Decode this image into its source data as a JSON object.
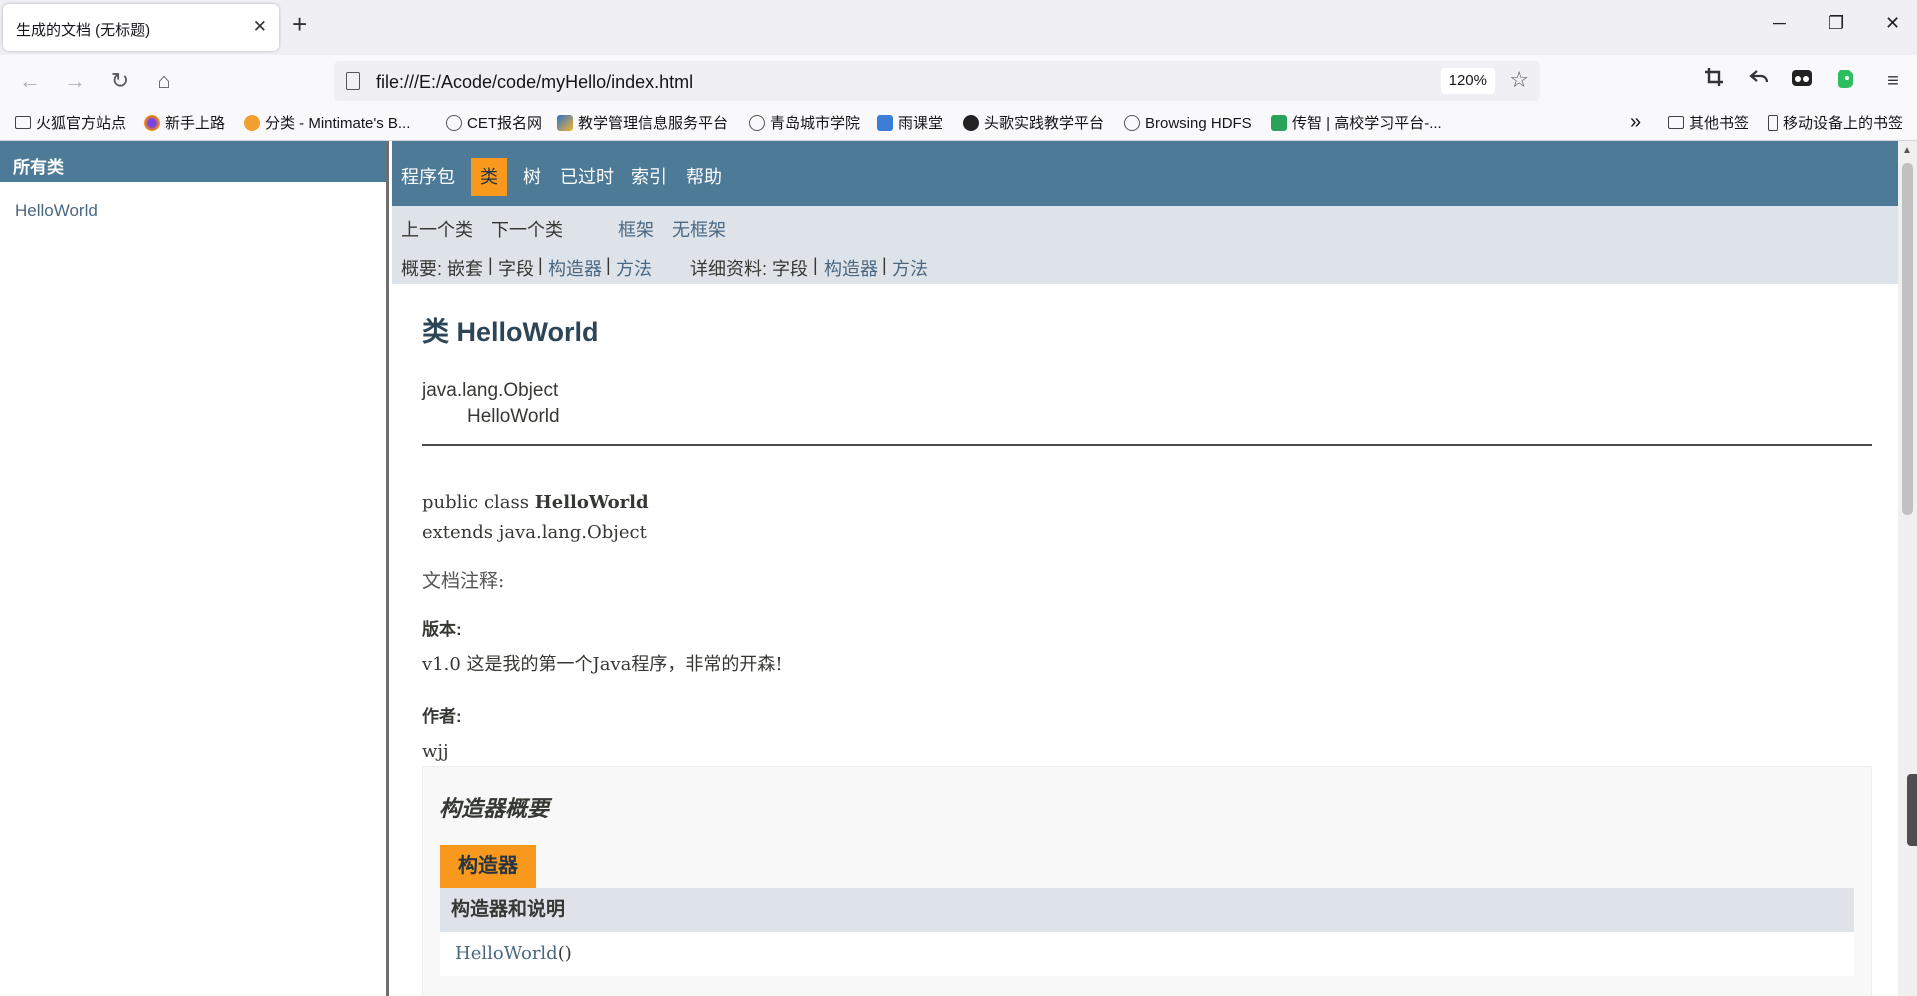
{
  "browser": {
    "tab_title": "生成的文档 (无标题)",
    "tab_close": "✕",
    "new_tab": "+",
    "window_controls": {
      "minimize": "─",
      "restore": "❐",
      "close": "✕"
    },
    "nav": {
      "back": "←",
      "forward": "→",
      "reload": "↻",
      "home": "⌂"
    },
    "url": "file:///E:/Acode/code/myHello/index.html",
    "zoom": "120%",
    "star": "☆",
    "toolbar_icons": [
      "crop-icon",
      "undo-icon",
      "extension-icon",
      "evernote-icon",
      "menu-icon"
    ],
    "bookmarks": [
      {
        "label": "火狐官方站点",
        "icon": "folder-icon",
        "color": "#444444"
      },
      {
        "label": "新手上路",
        "icon": "firefox-icon",
        "color": "#e66000"
      },
      {
        "label": "分类 - Mintimate's B...",
        "icon": "mint-icon",
        "color": "#f0a030"
      },
      {
        "label": "CET报名网",
        "icon": "globe-icon",
        "color": "#555555"
      },
      {
        "label": "教学管理信息服务平台",
        "icon": "cube-icon",
        "color": "#2f6fc8"
      },
      {
        "label": "青岛城市学院",
        "icon": "globe-icon",
        "color": "#555555"
      },
      {
        "label": "雨课堂",
        "icon": "rain-icon",
        "color": "#3c7ed6"
      },
      {
        "label": "头歌实践教学平台",
        "icon": "github-icon",
        "color": "#222222"
      },
      {
        "label": "Browsing HDFS",
        "icon": "globe-icon",
        "color": "#555555"
      },
      {
        "label": "传智 | 高校学习平台-...",
        "icon": "cap-icon",
        "color": "#2aa35a"
      }
    ],
    "overflow": "»",
    "other_bookmarks": "其他书签",
    "mobile_bookmarks": "移动设备上的书签"
  },
  "left_frame": {
    "header": "所有类",
    "items": [
      "HelloWorld"
    ]
  },
  "top_nav": {
    "items": [
      "程序包",
      "类",
      "树",
      "已过时",
      "索引",
      "帮助"
    ],
    "active": "类"
  },
  "sub_nav": {
    "prev_class": "上一个类",
    "next_class": "下一个类",
    "frames": "框架",
    "no_frames": "无框架",
    "summary_label": "概要:",
    "summary_nested": "嵌套",
    "summary_field": "字段",
    "summary_constructor": "构造器",
    "summary_method": "方法",
    "detail_label": "详细资料:",
    "detail_field": "字段",
    "detail_constructor": "构造器",
    "detail_method": "方法",
    "sep": "|"
  },
  "class_doc": {
    "title": "类 HelloWorld",
    "inheritance": [
      "java.lang.Object",
      "HelloWorld"
    ],
    "decl_prefix": "public class ",
    "decl_name": "HelloWorld",
    "decl_extends": "extends java.lang.Object",
    "doc_note": "文档注释:",
    "version_label": "版本:",
    "version_value": "v1.0 这是我的第一个Java程序，非常的开森!",
    "author_label": "作者:",
    "author_value": "wjj"
  },
  "constructor_summary": {
    "title": "构造器概要",
    "caption": "构造器",
    "column_header": "构造器和说明",
    "rows": [
      {
        "name": "HelloWorld",
        "params": "()"
      }
    ]
  },
  "colors": {
    "nav_blue": "#4d7a97",
    "accent_orange": "#f8981d",
    "subnav_gray": "#dee3e9",
    "link": "#4a6782"
  }
}
